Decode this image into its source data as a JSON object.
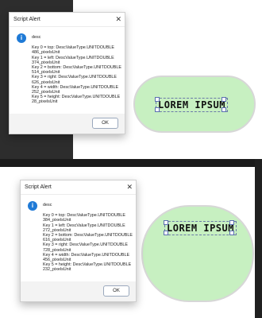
{
  "panels": [
    {
      "dialog": {
        "title": "Script Alert",
        "close_glyph": "✕",
        "info_glyph": "i",
        "heading": "desc",
        "lines": [
          "Key 0 = top: DescValueType.UNITDOUBLE",
          "486_pixelsUnit",
          "Key 1 = left: DescValueType.UNITDOUBLE",
          "374_pixelsUnit",
          "Key 2 = bottom: DescValueType.UNITDOUBLE",
          "514_pixelsUnit",
          "Key 3 = right: DescValueType.UNITDOUBLE",
          "626_pixelsUnit",
          "Key 4 = width: DescValueType.UNITDOUBLE",
          "252_pixelsUnit",
          "Key 5 = height: DescValueType.UNITDOUBLE",
          "28_pixelsUnit"
        ],
        "ok_label": "OK"
      },
      "canvas_text": "LOREM IPSUM"
    },
    {
      "dialog": {
        "title": "Script Alert",
        "close_glyph": "✕",
        "info_glyph": "i",
        "heading": "desc",
        "lines": [
          "Key 0 = top: DescValueType.UNITDOUBLE",
          "384_pixelsUnit",
          "Key 1 = left: DescValueType.UNITDOUBLE",
          "272_pixelsUnit",
          "Key 2 = bottom: DescValueType.UNITDOUBLE",
          "616_pixelsUnit",
          "Key 3 = right: DescValueType.UNITDOUBLE",
          "728_pixelsUnit",
          "Key 4 = width: DescValueType.UNITDOUBLE",
          "456_pixelsUnit",
          "Key 5 = height: DescValueType.UNITDOUBLE",
          "232_pixelsUnit"
        ],
        "ok_label": "OK"
      },
      "canvas_text": "LOREM IPSUM"
    }
  ],
  "colors": {
    "shape_fill": "#c7f0c1",
    "dark_background": "#2d2d2d",
    "info_icon": "#1f7ad6"
  },
  "icons": {
    "info": "info-icon",
    "close": "close-icon"
  }
}
